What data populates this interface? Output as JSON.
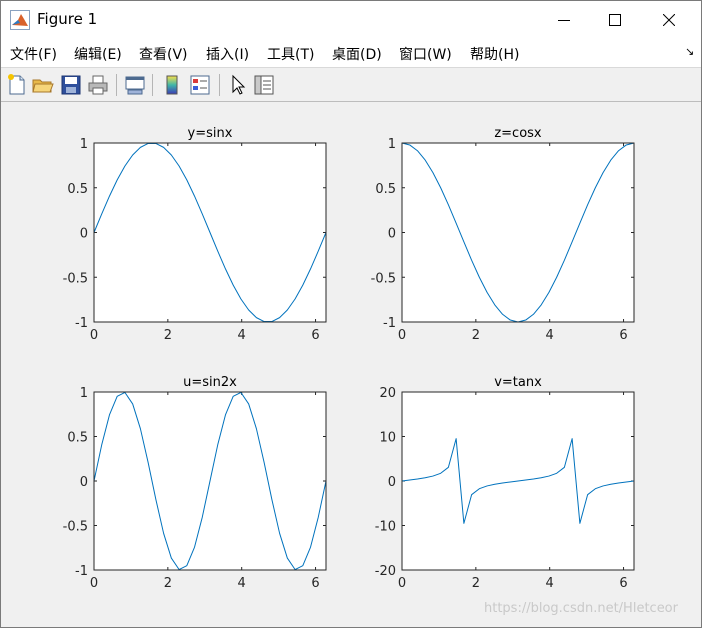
{
  "window": {
    "title": "Figure 1"
  },
  "menu": [
    {
      "label": "文件(F)",
      "key": "file"
    },
    {
      "label": "编辑(E)",
      "key": "edit"
    },
    {
      "label": "查看(V)",
      "key": "view"
    },
    {
      "label": "插入(I)",
      "key": "insert"
    },
    {
      "label": "工具(T)",
      "key": "tools"
    },
    {
      "label": "桌面(D)",
      "key": "desktop"
    },
    {
      "label": "窗口(W)",
      "key": "window"
    },
    {
      "label": "帮助(H)",
      "key": "help"
    }
  ],
  "menu_dock_glyph": "↘",
  "toolbar": {
    "icons": [
      "new-figure-icon",
      "open-file-icon",
      "save-icon",
      "print-icon",
      "link-plot-icon",
      "insert-colorbar-icon",
      "insert-legend-icon",
      "edit-plot-icon",
      "property-editor-icon"
    ]
  },
  "watermark": "https://blog.csdn.net/Hletceor",
  "colors": {
    "line": "#0072bd",
    "axes_bg": "#ffffff",
    "figure_bg": "#f0f0f0"
  },
  "chart_data": [
    {
      "type": "line",
      "title": "y=sinx",
      "xlim": [
        0,
        6.2832
      ],
      "ylim": [
        -1,
        1
      ],
      "xticks": [
        0,
        2,
        4,
        6
      ],
      "yticks": [
        -1,
        -0.5,
        0,
        0.5,
        1
      ],
      "xticklabels": [
        "0",
        "2",
        "4",
        "6"
      ],
      "yticklabels": [
        "-1",
        "-0.5",
        "0",
        "0.5",
        "1"
      ],
      "x": [
        0,
        0.2094,
        0.4189,
        0.6283,
        0.8378,
        1.0472,
        1.2566,
        1.4661,
        1.6755,
        1.885,
        2.0944,
        2.3038,
        2.5133,
        2.7227,
        2.9322,
        3.1416,
        3.351,
        3.5605,
        3.7699,
        3.9794,
        4.1888,
        4.3982,
        4.6077,
        4.8171,
        5.0265,
        5.236,
        5.4454,
        5.6549,
        5.8643,
        6.0737,
        6.2832
      ],
      "y": [
        0,
        0.2079,
        0.4067,
        0.5878,
        0.7431,
        0.866,
        0.9511,
        0.9945,
        0.9945,
        0.9511,
        0.866,
        0.7431,
        0.5878,
        0.4067,
        0.2079,
        0,
        -0.2079,
        -0.4067,
        -0.5878,
        -0.7431,
        -0.866,
        -0.9511,
        -0.9945,
        -0.9945,
        -0.9511,
        -0.866,
        -0.7431,
        -0.5878,
        -0.4067,
        -0.2079,
        0
      ]
    },
    {
      "type": "line",
      "title": "z=cosx",
      "xlim": [
        0,
        6.2832
      ],
      "ylim": [
        -1,
        1
      ],
      "xticks": [
        0,
        2,
        4,
        6
      ],
      "yticks": [
        -1,
        -0.5,
        0,
        0.5,
        1
      ],
      "xticklabels": [
        "0",
        "2",
        "4",
        "6"
      ],
      "yticklabels": [
        "-1",
        "-0.5",
        "0",
        "0.5",
        "1"
      ],
      "x": [
        0,
        0.2094,
        0.4189,
        0.6283,
        0.8378,
        1.0472,
        1.2566,
        1.4661,
        1.6755,
        1.885,
        2.0944,
        2.3038,
        2.5133,
        2.7227,
        2.9322,
        3.1416,
        3.351,
        3.5605,
        3.7699,
        3.9794,
        4.1888,
        4.3982,
        4.6077,
        4.8171,
        5.0265,
        5.236,
        5.4454,
        5.6549,
        5.8643,
        6.0737,
        6.2832
      ],
      "y": [
        1,
        0.9781,
        0.9135,
        0.809,
        0.6691,
        0.5,
        0.309,
        0.1045,
        -0.1045,
        -0.309,
        -0.5,
        -0.6691,
        -0.809,
        -0.9135,
        -0.9781,
        -1,
        -0.9781,
        -0.9135,
        -0.809,
        -0.6691,
        -0.5,
        -0.309,
        -0.1045,
        0.1045,
        0.309,
        0.5,
        0.6691,
        0.809,
        0.9135,
        0.9781,
        1
      ]
    },
    {
      "type": "line",
      "title": "u=sin2x",
      "xlim": [
        0,
        6.2832
      ],
      "ylim": [
        -1,
        1
      ],
      "xticks": [
        0,
        2,
        4,
        6
      ],
      "yticks": [
        -1,
        -0.5,
        0,
        0.5,
        1
      ],
      "xticklabels": [
        "0",
        "2",
        "4",
        "6"
      ],
      "yticklabels": [
        "-1",
        "-0.5",
        "0",
        "0.5",
        "1"
      ],
      "x": [
        0,
        0.2094,
        0.4189,
        0.6283,
        0.8378,
        1.0472,
        1.2566,
        1.4661,
        1.6755,
        1.885,
        2.0944,
        2.3038,
        2.5133,
        2.7227,
        2.9322,
        3.1416,
        3.351,
        3.5605,
        3.7699,
        3.9794,
        4.1888,
        4.3982,
        4.6077,
        4.8171,
        5.0265,
        5.236,
        5.4454,
        5.6549,
        5.8643,
        6.0737,
        6.2832
      ],
      "y": [
        0,
        0.4067,
        0.7431,
        0.9511,
        0.9945,
        0.866,
        0.5878,
        0.2079,
        -0.2079,
        -0.5878,
        -0.866,
        -0.9945,
        -0.9511,
        -0.7431,
        -0.4067,
        0,
        0.4067,
        0.7431,
        0.9511,
        0.9945,
        0.866,
        0.5878,
        0.2079,
        -0.2079,
        -0.5878,
        -0.866,
        -0.9945,
        -0.9511,
        -0.7431,
        -0.4067,
        0
      ]
    },
    {
      "type": "line",
      "title": "v=tanx",
      "xlim": [
        0,
        6.2832
      ],
      "ylim": [
        -20,
        20
      ],
      "xticks": [
        0,
        2,
        4,
        6
      ],
      "yticks": [
        -20,
        -10,
        0,
        10,
        20
      ],
      "xticklabels": [
        "0",
        "2",
        "4",
        "6"
      ],
      "yticklabels": [
        "-20",
        "-10",
        "0",
        "10",
        "20"
      ],
      "x": [
        0,
        0.2094,
        0.4189,
        0.6283,
        0.8378,
        1.0472,
        1.2566,
        1.4661,
        1.6755,
        1.885,
        2.0944,
        2.3038,
        2.5133,
        2.7227,
        2.9322,
        3.1416,
        3.351,
        3.5605,
        3.7699,
        3.9794,
        4.1888,
        4.3982,
        4.6077,
        4.8171,
        5.0265,
        5.236,
        5.4454,
        5.6549,
        5.8643,
        6.0737,
        6.2832
      ],
      "y": [
        0,
        0.2126,
        0.4452,
        0.7265,
        1.1106,
        1.7321,
        3.0777,
        9.5144,
        -9.5144,
        -3.0777,
        -1.7321,
        -1.1106,
        -0.7265,
        -0.4452,
        -0.2126,
        0,
        0.2126,
        0.4452,
        0.7265,
        1.1106,
        1.7321,
        3.0777,
        9.5144,
        -9.5144,
        -3.0777,
        -1.7321,
        -1.1106,
        -0.7265,
        -0.4452,
        -0.2126,
        0
      ]
    }
  ]
}
